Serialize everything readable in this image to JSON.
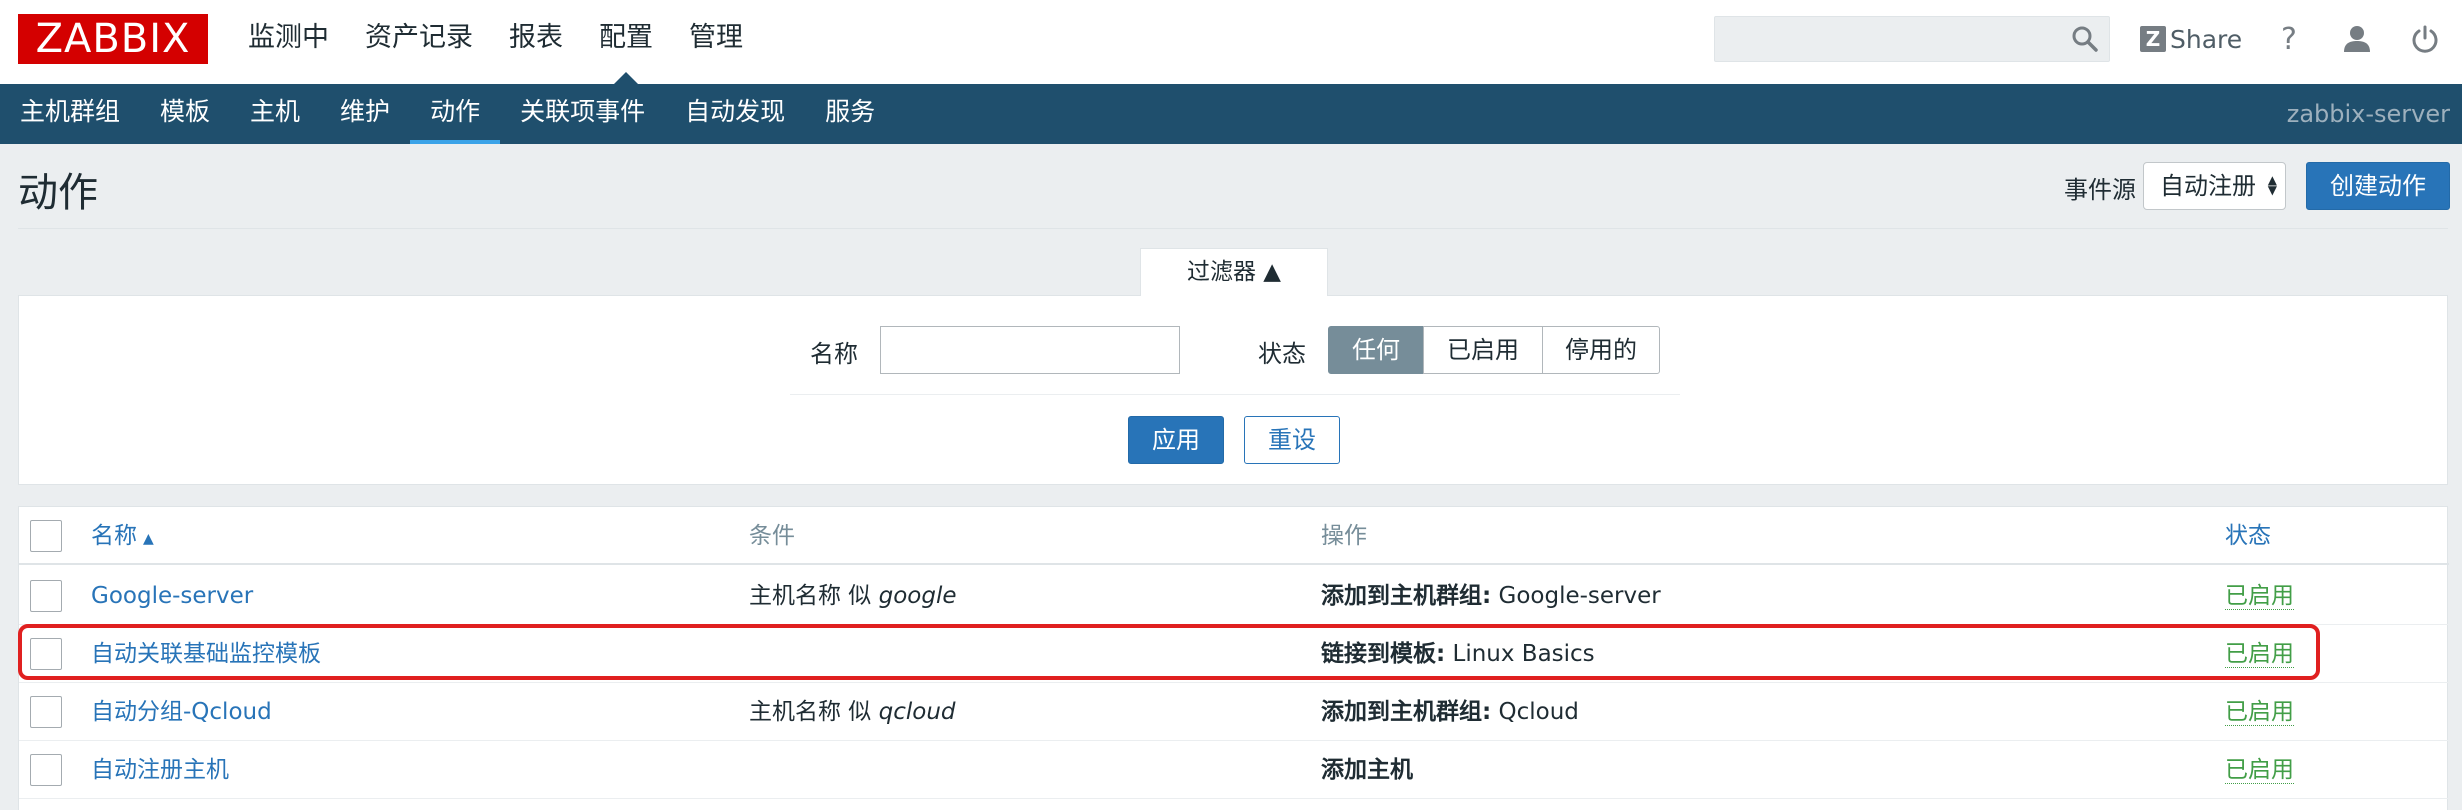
{
  "header": {
    "logo": "ZABBIX",
    "menu": [
      "监测中",
      "资产记录",
      "报表",
      "配置",
      "管理"
    ],
    "active_menu": "配置",
    "search": {
      "value": "",
      "placeholder": ""
    },
    "share_label": "Share",
    "share_icon_letter": "Z",
    "help_label": "?"
  },
  "subnav": {
    "items": [
      "主机群组",
      "模板",
      "主机",
      "维护",
      "动作",
      "关联项事件",
      "自动发现",
      "服务"
    ],
    "active": "动作",
    "server_name": "zabbix-server"
  },
  "page": {
    "title": "动作",
    "event_source_label": "事件源",
    "event_source_value": "自动注册",
    "create_button": "创建动作"
  },
  "filter": {
    "tab_label": "过滤器 ▲",
    "name_label": "名称",
    "name_value": "",
    "status_label": "状态",
    "status_options": [
      "任何",
      "已启用",
      "停用的"
    ],
    "status_selected": "任何",
    "apply_button": "应用",
    "reset_button": "重设"
  },
  "table": {
    "headers": {
      "name": "名称",
      "conditions": "条件",
      "operations": "操作",
      "status": "状态"
    },
    "sort_indicator": "▲",
    "rows": [
      {
        "name": "Google-server",
        "condition_prefix": "主机名称 似 ",
        "condition_value": "google",
        "operation_prefix": "添加到主机群组:",
        "operation_value": " Google-server",
        "status": "已启用"
      },
      {
        "name": "自动关联基础监控模板",
        "condition_prefix": "",
        "condition_value": "",
        "operation_prefix": "链接到模板:",
        "operation_value": " Linux Basics",
        "status": "已启用"
      },
      {
        "name": "自动分组-Qcloud",
        "condition_prefix": "主机名称 似 ",
        "condition_value": "qcloud",
        "operation_prefix": "添加到主机群组:",
        "operation_value": " Qcloud",
        "status": "已启用"
      },
      {
        "name": "自动注册主机",
        "condition_prefix": "",
        "condition_value": "",
        "operation_prefix": "添加主机",
        "operation_value": "",
        "status": "已启用"
      }
    ]
  },
  "colors": {
    "logo_red": "#d40000",
    "subnav_bg": "#1f4f6d",
    "accent_blue": "#2874b8",
    "status_green": "#429e47",
    "highlight_red": "#e02020"
  }
}
